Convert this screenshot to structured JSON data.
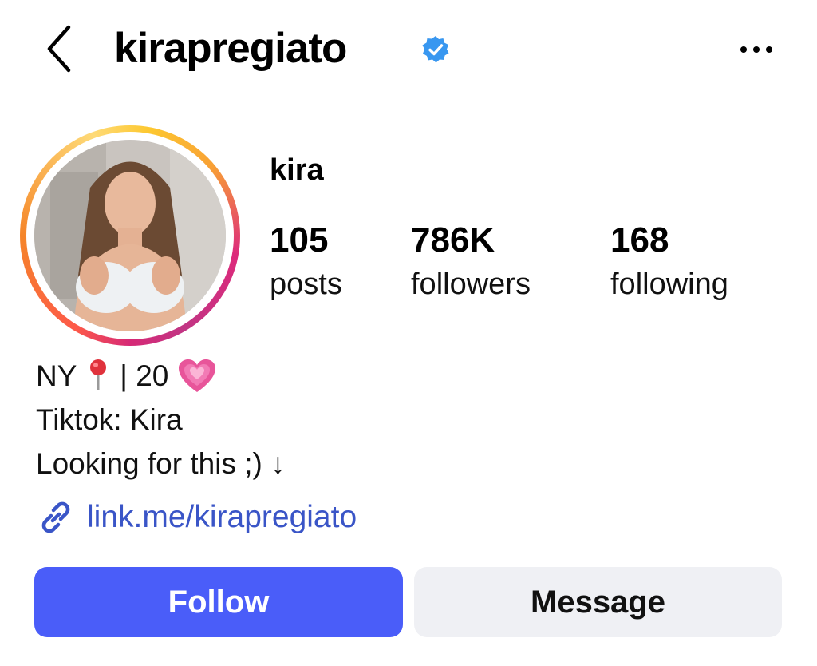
{
  "header": {
    "username": "kirapregiato",
    "back_icon": "chevron-left-icon",
    "verified_icon": "verified-badge-icon",
    "more_icon": "more-horizontal-icon"
  },
  "profile": {
    "display_name": "kira",
    "stats": [
      {
        "value": "105",
        "label": "posts"
      },
      {
        "value": "786K",
        "label": "followers"
      },
      {
        "value": "168",
        "label": "following"
      }
    ],
    "bio": {
      "line1_a": "NY",
      "line1_b": "| 20",
      "line2": "Tiktok: Kira",
      "line3": "Looking for this ;) ↓"
    },
    "link": {
      "icon": "link-icon",
      "text": "link.me/kirapregiato"
    }
  },
  "actions": {
    "follow_label": "Follow",
    "message_label": "Message"
  },
  "colors": {
    "accent_blue": "#4a5df9",
    "link_blue": "#3a55c7",
    "verified_blue": "#3897f0",
    "secondary_button": "#eff0f4"
  }
}
